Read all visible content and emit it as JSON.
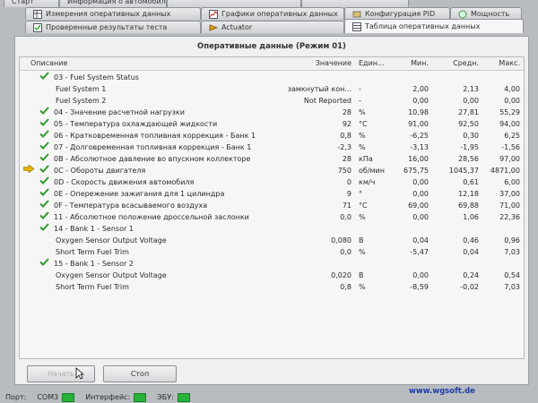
{
  "tabs_row1": [
    {
      "label": "Старт"
    },
    {
      "label": "Информация о автомобиле"
    },
    {
      "label": ""
    },
    {
      "label": ""
    }
  ],
  "tabs_row2": [
    {
      "label": "Измерения оперативных данных"
    },
    {
      "label": "Графики оперативных данных"
    },
    {
      "label": "Конфигурация PID"
    },
    {
      "label": "Мощность"
    }
  ],
  "tabs_row3": [
    {
      "label": "Проверенные результаты теста"
    },
    {
      "label": "Actuator"
    },
    {
      "label": "Таблица оперативных данных"
    }
  ],
  "panel_title": "Оперативные данные (Режим 01)",
  "columns": {
    "desc": "Описание",
    "value": "Значение",
    "unit": "Един...",
    "min": "Мин.",
    "avg": "Средн.",
    "max": "Макс."
  },
  "rows": [
    {
      "desc": "03 - Fuel System Status",
      "value": "",
      "unit": "",
      "min": "",
      "avg": "",
      "max": "",
      "mark": "check"
    },
    {
      "desc": "Fuel System 1",
      "value": "замкнутый кон...",
      "unit": "-",
      "min": "2,00",
      "avg": "2,13",
      "max": "4,00",
      "mark": "sub"
    },
    {
      "desc": "Fuel System 2",
      "value": "Not Reported",
      "unit": "-",
      "min": "0,00",
      "avg": "0,00",
      "max": "0,00",
      "mark": "sub"
    },
    {
      "desc": "04 - Значение расчетной нагрузки",
      "value": "28",
      "unit": "%",
      "min": "10,98",
      "avg": "27,81",
      "max": "55,29",
      "mark": "check"
    },
    {
      "desc": "05 - Температура охлаждающей жидкости",
      "value": "92",
      "unit": "°C",
      "min": "91,00",
      "avg": "92,50",
      "max": "94,00",
      "mark": "check"
    },
    {
      "desc": "06 - Кратковременная топливная коррекция - Банк 1",
      "value": "0,8",
      "unit": "%",
      "min": "-6,25",
      "avg": "0,30",
      "max": "6,25",
      "mark": "check"
    },
    {
      "desc": "07 - Долговременная топливная коррекция - Банк 1",
      "value": "-2,3",
      "unit": "%",
      "min": "-3,13",
      "avg": "-1,95",
      "max": "-1,56",
      "mark": "check"
    },
    {
      "desc": "0B - Абсолютное давление во впускном коллекторе",
      "value": "28",
      "unit": "кПа",
      "min": "16,00",
      "avg": "28,56",
      "max": "97,00",
      "mark": "check"
    },
    {
      "desc": "0C - Обороты двигателя",
      "value": "750",
      "unit": "об/мин",
      "min": "675,75",
      "avg": "1045,37",
      "max": "4871,00",
      "mark": "arrow"
    },
    {
      "desc": "0D - Скорость движения автомобиля",
      "value": "0",
      "unit": "км/ч",
      "min": "0,00",
      "avg": "0,61",
      "max": "6,00",
      "mark": "check"
    },
    {
      "desc": "0E - Опережение зажигания для 1 цилиндра",
      "value": "9",
      "unit": "°",
      "min": "0,00",
      "avg": "12,18",
      "max": "37,00",
      "mark": "check"
    },
    {
      "desc": "0F - Температура  всасываемого воздуха",
      "value": "71",
      "unit": "°C",
      "min": "69,00",
      "avg": "69,88",
      "max": "71,00",
      "mark": "check"
    },
    {
      "desc": "11 - Абсолютное положение дроссельной заслонки",
      "value": "0,0",
      "unit": "%",
      "min": "0,00",
      "avg": "1,06",
      "max": "22,36",
      "mark": "check"
    },
    {
      "desc": "14 - Bank 1 - Sensor 1",
      "value": "",
      "unit": "",
      "min": "",
      "avg": "",
      "max": "",
      "mark": "check"
    },
    {
      "desc": "Oxygen Sensor Output Voltage",
      "value": "0,080",
      "unit": "В",
      "min": "0,04",
      "avg": "0,46",
      "max": "0,96",
      "mark": "sub"
    },
    {
      "desc": "Short Term Fuel Trim",
      "value": "0,0",
      "unit": "%",
      "min": "-5,47",
      "avg": "0,04",
      "max": "7,03",
      "mark": "sub"
    },
    {
      "desc": "15 - Bank 1 - Sensor 2",
      "value": "",
      "unit": "",
      "min": "",
      "avg": "",
      "max": "",
      "mark": "check2"
    },
    {
      "desc": "Oxygen Sensor Output Voltage",
      "value": "0,020",
      "unit": "В",
      "min": "0,00",
      "avg": "0,24",
      "max": "0,54",
      "mark": "sub"
    },
    {
      "desc": "Short Term Fuel Trim",
      "value": "0,8",
      "unit": "%",
      "min": "-8,59",
      "avg": "-0,02",
      "max": "7,03",
      "mark": "sub"
    }
  ],
  "buttons": {
    "start": "Начать",
    "stop": "Стоп"
  },
  "status": {
    "port_label": "Порт:",
    "port_value": "COM3",
    "interface_label": "Интерфейс:",
    "ecu_label": "ЭБУ:"
  },
  "footer_url": "www.wgsoft.de",
  "colors": {
    "check": "#2f9a2f",
    "arrow": "#e2b400",
    "link": "#1f3aa8",
    "led": "#27b33a"
  }
}
